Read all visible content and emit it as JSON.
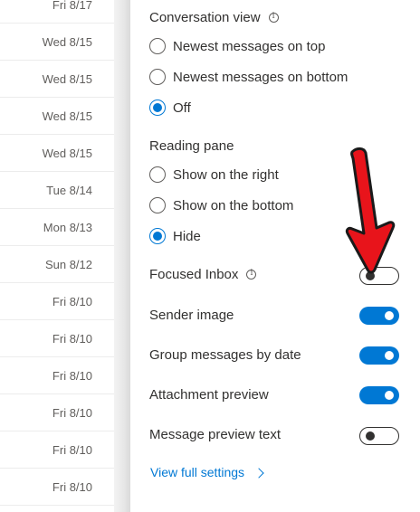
{
  "mail_list": {
    "dates": [
      "Fri 8/17",
      "Wed 8/15",
      "Wed 8/15",
      "Wed 8/15",
      "Wed 8/15",
      "Tue 8/14",
      "Mon 8/13",
      "Sun 8/12",
      "Fri 8/10",
      "Fri 8/10",
      "Fri 8/10",
      "Fri 8/10",
      "Fri 8/10",
      "Fri 8/10"
    ]
  },
  "settings": {
    "conversation_view": {
      "title": "Conversation view",
      "options": [
        "Newest messages on top",
        "Newest messages on bottom",
        "Off"
      ],
      "selected": "Off"
    },
    "reading_pane": {
      "title": "Reading pane",
      "options": [
        "Show on the right",
        "Show on the bottom",
        "Hide"
      ],
      "selected": "Hide"
    },
    "toggles": {
      "focused_inbox": {
        "label": "Focused Inbox",
        "on": false
      },
      "sender_image": {
        "label": "Sender image",
        "on": true
      },
      "group_by_date": {
        "label": "Group messages by date",
        "on": true
      },
      "attachment_preview": {
        "label": "Attachment preview",
        "on": true
      },
      "preview_text": {
        "label": "Message preview text",
        "on": false
      }
    },
    "view_full_settings": "View full settings"
  },
  "colors": {
    "accent": "#0078d4",
    "annotation_arrow": "#e8141b"
  },
  "icons": {
    "info": "info-icon",
    "chevron": "chevron-right-icon"
  }
}
